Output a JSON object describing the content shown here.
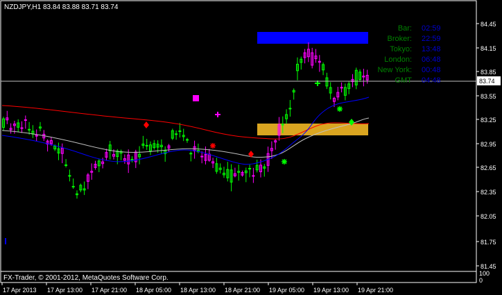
{
  "header": {
    "symbol_label": "NZDJPY,H1",
    "ohlc_label": "83.84 83.88 83.71 83.74"
  },
  "price_axis": {
    "ticks": [
      "84.45",
      "84.15",
      "83.85",
      "83.55",
      "83.25",
      "82.95",
      "82.65",
      "82.35",
      "82.05",
      "81.75",
      "81.45"
    ],
    "current_price": "83.74",
    "indicator_top": "100",
    "indicator_bottom": "0"
  },
  "time_axis": {
    "ticks": [
      "17 Apr 2013",
      "17 Apr 13:00",
      "17 Apr 21:00",
      "18 Apr 05:00",
      "18 Apr 13:00",
      "18 Apr 21:00",
      "19 Apr 05:00",
      "19 Apr 13:00",
      "19 Apr 21:00"
    ]
  },
  "info_panel": {
    "rows": [
      {
        "label": "Bar:",
        "value": "02:59"
      },
      {
        "label": "Broker:",
        "value": "22:59"
      },
      {
        "label": "Tokyo:",
        "value": "13:48"
      },
      {
        "label": "London:",
        "value": "06:48"
      },
      {
        "label": "New York:",
        "value": "00:48"
      },
      {
        "label": "GMT",
        "value": "04:48"
      }
    ]
  },
  "copyright": "FX-Trader, © 2001-2012, MetaQuotes Software Corp.",
  "colors": {
    "background": "#000000",
    "foreground": "#ffffff",
    "bull_candle": "#00ff00",
    "bear_candle": "#ff00ff",
    "ma_fast": "#0000ff",
    "ma_mid": "#c0c0c0",
    "ma_slow": "#ff0000",
    "info_label": "#008000",
    "info_value": "#0000cd",
    "box_blue": "#0000ff",
    "box_gold": "#daa520"
  }
}
